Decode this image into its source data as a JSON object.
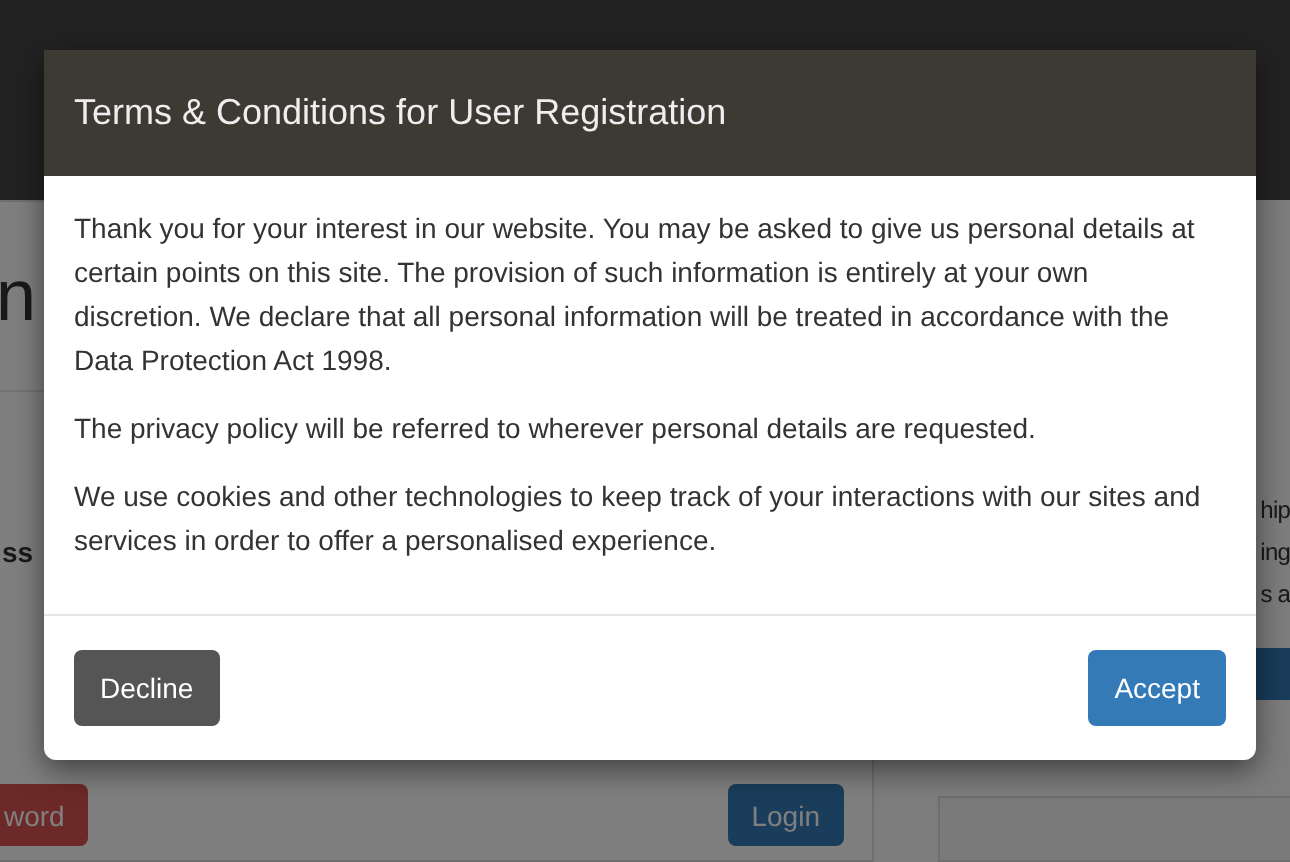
{
  "background_page": {
    "heading_fragment": "n",
    "label_fragment": "ss",
    "side_fragments": [
      "hip",
      "ing",
      "s a"
    ],
    "buttons": [
      {
        "label": "word",
        "kind": "danger"
      },
      {
        "label": "Login",
        "kind": "primary"
      }
    ]
  },
  "modal": {
    "title": "Terms & Conditions for User Registration",
    "paragraphs": [
      "Thank you for your interest in our website. You may be asked to give us personal details at certain points on this site. The provision of such information is entirely at your own discretion. We declare that all personal information will be treated in accordance with the Data Protection Act 1998.",
      "The privacy policy will be referred to wherever personal details are requested.",
      "We use cookies and other technologies to keep track of your interactions with our sites and services in order to offer a personalised experience."
    ],
    "buttons": [
      {
        "label": "Decline",
        "kind": "secondary"
      },
      {
        "label": "Accept",
        "kind": "primary"
      }
    ]
  }
}
